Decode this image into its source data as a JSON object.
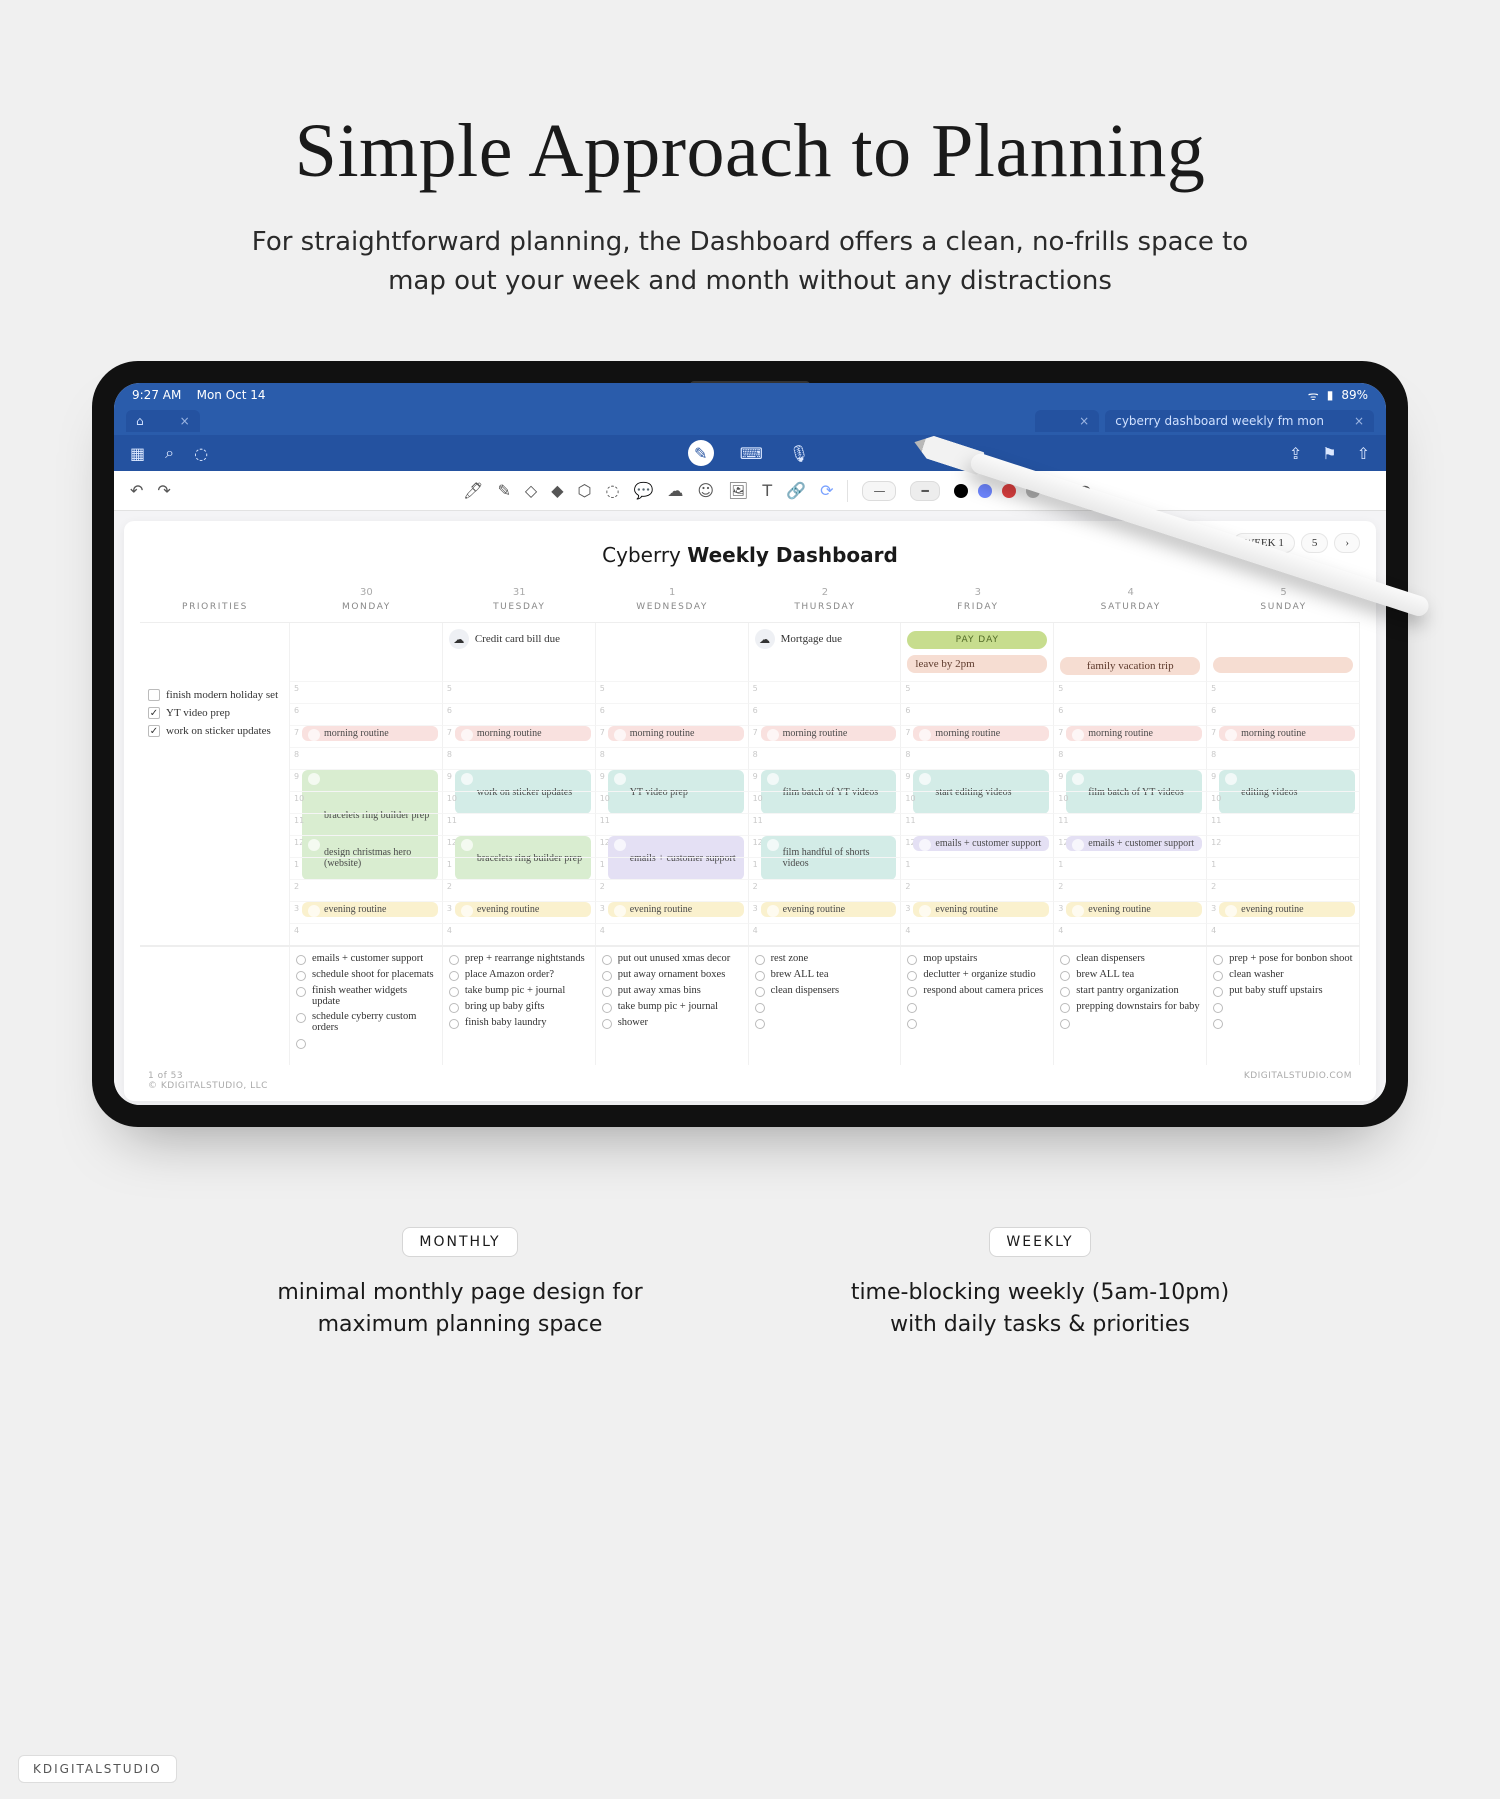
{
  "hero": {
    "title": "Simple Approach to Planning",
    "subtitle": "For straightforward planning, the Dashboard offers a clean, no-frills space to map out your week and month without any distractions"
  },
  "status": {
    "time": "9:27 AM",
    "date": "Mon Oct 14",
    "battery": "89%"
  },
  "tabs": {
    "doc": "cyberry dashboard weekly fm mon"
  },
  "weeknav": {
    "w1": "WEEK 1",
    "w5": "5",
    "arrow": "›"
  },
  "paper": {
    "titleA": "Cyberry ",
    "titleB": "Weekly Dashboard"
  },
  "days": [
    {
      "num": "30",
      "dow": "MONDAY"
    },
    {
      "num": "31",
      "dow": "TUESDAY"
    },
    {
      "num": "1",
      "dow": "WEDNESDAY"
    },
    {
      "num": "2",
      "dow": "THURSDAY"
    },
    {
      "num": "3",
      "dow": "FRIDAY"
    },
    {
      "num": "4",
      "dow": "SATURDAY"
    },
    {
      "num": "5",
      "dow": "SUNDAY"
    }
  ],
  "priorLabel": "PRIORITIES",
  "allday": {
    "tue": "Credit card bill due",
    "thu": "Mortgage due",
    "fri_pay": "PAY DAY",
    "fri_leave": "leave by 2pm",
    "trip": "family vacation trip"
  },
  "priorities": [
    {
      "done": false,
      "t": "finish modern holiday set"
    },
    {
      "done": true,
      "t": "YT video prep"
    },
    {
      "done": true,
      "t": "work on sticker updates"
    }
  ],
  "hours": [
    "5",
    "6",
    "7",
    "8",
    "9",
    "10",
    "11",
    "12",
    "1",
    "2",
    "3",
    "4",
    "5",
    "6",
    "7",
    "8",
    "9",
    "10"
  ],
  "routine": "morning routine",
  "evening": "evening routine",
  "blocks": {
    "mon": [
      {
        "t": "bracelets ring builder prep",
        "c": "greenB",
        "h": "taller"
      },
      {
        "t": "design christmas hero (website)",
        "c": "greenB",
        "h": "tall"
      }
    ],
    "tue": [
      {
        "t": "work on sticker updates",
        "c": "tealB",
        "h": "tall"
      },
      {
        "t": "bracelets ring builder prep",
        "c": "greenB",
        "h": "tall"
      }
    ],
    "wed": [
      {
        "t": "YT video prep",
        "c": "tealB",
        "h": "tall"
      },
      {
        "t": "emails + customer support",
        "c": "violetB",
        "h": "tall"
      }
    ],
    "thu": [
      {
        "t": "film batch of YT videos",
        "c": "tealB",
        "h": "tall"
      },
      {
        "t": "film handful of shorts videos",
        "c": "tealB",
        "h": "tall"
      }
    ],
    "fri": [
      {
        "t": "start editing videos",
        "c": "tealB",
        "h": "tall"
      },
      {
        "t": "emails + customer support",
        "c": "violetB",
        "h": ""
      }
    ],
    "sat": [
      {
        "t": "film batch of YT videos",
        "c": "tealB",
        "h": "tall"
      },
      {
        "t": "emails + customer support",
        "c": "violetB",
        "h": ""
      }
    ],
    "sun": [
      {
        "t": "editing videos",
        "c": "tealB",
        "h": "tall"
      }
    ]
  },
  "tasks": {
    "mon": [
      "emails + customer support",
      "schedule shoot for placemats",
      "finish weather widgets update",
      "schedule cyberry custom orders"
    ],
    "tue": [
      "prep + rearrange nightstands",
      "place Amazon order?",
      "take bump pic + journal",
      "bring up baby gifts",
      "finish baby laundry"
    ],
    "wed": [
      "put out unused xmas decor",
      "put away ornament boxes",
      "put away xmas bins",
      "take bump pic + journal",
      "shower"
    ],
    "thu": [
      "rest zone",
      "brew ALL tea",
      "clean dispensers"
    ],
    "fri": [
      "mop upstairs",
      "declutter + organize studio",
      "respond about camera prices"
    ],
    "sat": [
      "clean dispensers",
      "brew ALL tea",
      "start pantry organization",
      "prepping downstairs for baby"
    ],
    "sun": [
      "prep + pose for bonbon shoot",
      "clean washer",
      "put baby stuff upstairs"
    ]
  },
  "pgfoot": {
    "l": "1 of 53",
    "cpr": "© KDIGITALSTUDIO, LLC",
    "r": "KDIGITALSTUDIO.COM"
  },
  "captions": {
    "monthly": {
      "tag": "MONTHLY",
      "text": "minimal monthly page design for maximum planning space"
    },
    "weekly": {
      "tag": "WEEKLY",
      "text": "time-blocking weekly (5am-10pm) with daily tasks & priorities"
    }
  },
  "brand": "KDIGITALSTUDIO",
  "colors": {
    "black": "#000000",
    "blue": "#6e86ff",
    "red": "#e24141",
    "grey": "#b8b8b8",
    "gold": "#d8b559"
  }
}
